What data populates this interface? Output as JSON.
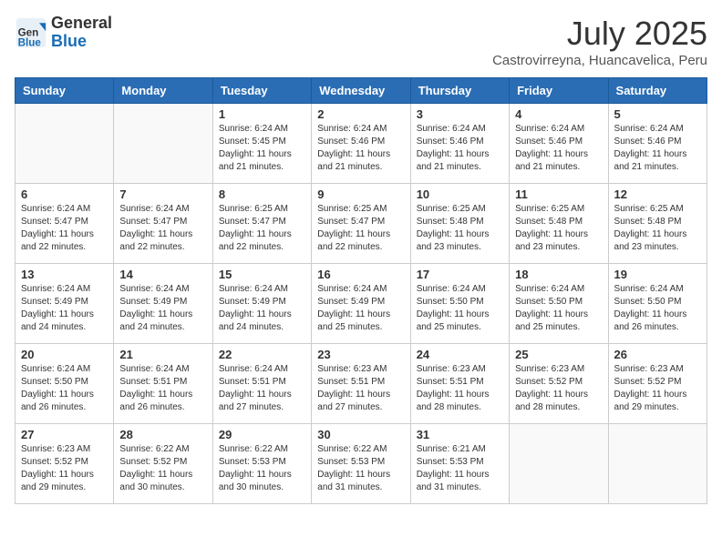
{
  "header": {
    "logo_general": "General",
    "logo_blue": "Blue",
    "month_year": "July 2025",
    "location": "Castrovirreyna, Huancavelica, Peru"
  },
  "days_of_week": [
    "Sunday",
    "Monday",
    "Tuesday",
    "Wednesday",
    "Thursday",
    "Friday",
    "Saturday"
  ],
  "weeks": [
    [
      {
        "day": "",
        "empty": true
      },
      {
        "day": "",
        "empty": true
      },
      {
        "day": "1",
        "sunrise": "6:24 AM",
        "sunset": "5:45 PM",
        "daylight": "11 hours and 21 minutes."
      },
      {
        "day": "2",
        "sunrise": "6:24 AM",
        "sunset": "5:46 PM",
        "daylight": "11 hours and 21 minutes."
      },
      {
        "day": "3",
        "sunrise": "6:24 AM",
        "sunset": "5:46 PM",
        "daylight": "11 hours and 21 minutes."
      },
      {
        "day": "4",
        "sunrise": "6:24 AM",
        "sunset": "5:46 PM",
        "daylight": "11 hours and 21 minutes."
      },
      {
        "day": "5",
        "sunrise": "6:24 AM",
        "sunset": "5:46 PM",
        "daylight": "11 hours and 21 minutes."
      }
    ],
    [
      {
        "day": "6",
        "sunrise": "6:24 AM",
        "sunset": "5:47 PM",
        "daylight": "11 hours and 22 minutes."
      },
      {
        "day": "7",
        "sunrise": "6:24 AM",
        "sunset": "5:47 PM",
        "daylight": "11 hours and 22 minutes."
      },
      {
        "day": "8",
        "sunrise": "6:25 AM",
        "sunset": "5:47 PM",
        "daylight": "11 hours and 22 minutes."
      },
      {
        "day": "9",
        "sunrise": "6:25 AM",
        "sunset": "5:47 PM",
        "daylight": "11 hours and 22 minutes."
      },
      {
        "day": "10",
        "sunrise": "6:25 AM",
        "sunset": "5:48 PM",
        "daylight": "11 hours and 23 minutes."
      },
      {
        "day": "11",
        "sunrise": "6:25 AM",
        "sunset": "5:48 PM",
        "daylight": "11 hours and 23 minutes."
      },
      {
        "day": "12",
        "sunrise": "6:25 AM",
        "sunset": "5:48 PM",
        "daylight": "11 hours and 23 minutes."
      }
    ],
    [
      {
        "day": "13",
        "sunrise": "6:24 AM",
        "sunset": "5:49 PM",
        "daylight": "11 hours and 24 minutes."
      },
      {
        "day": "14",
        "sunrise": "6:24 AM",
        "sunset": "5:49 PM",
        "daylight": "11 hours and 24 minutes."
      },
      {
        "day": "15",
        "sunrise": "6:24 AM",
        "sunset": "5:49 PM",
        "daylight": "11 hours and 24 minutes."
      },
      {
        "day": "16",
        "sunrise": "6:24 AM",
        "sunset": "5:49 PM",
        "daylight": "11 hours and 25 minutes."
      },
      {
        "day": "17",
        "sunrise": "6:24 AM",
        "sunset": "5:50 PM",
        "daylight": "11 hours and 25 minutes."
      },
      {
        "day": "18",
        "sunrise": "6:24 AM",
        "sunset": "5:50 PM",
        "daylight": "11 hours and 25 minutes."
      },
      {
        "day": "19",
        "sunrise": "6:24 AM",
        "sunset": "5:50 PM",
        "daylight": "11 hours and 26 minutes."
      }
    ],
    [
      {
        "day": "20",
        "sunrise": "6:24 AM",
        "sunset": "5:50 PM",
        "daylight": "11 hours and 26 minutes."
      },
      {
        "day": "21",
        "sunrise": "6:24 AM",
        "sunset": "5:51 PM",
        "daylight": "11 hours and 26 minutes."
      },
      {
        "day": "22",
        "sunrise": "6:24 AM",
        "sunset": "5:51 PM",
        "daylight": "11 hours and 27 minutes."
      },
      {
        "day": "23",
        "sunrise": "6:23 AM",
        "sunset": "5:51 PM",
        "daylight": "11 hours and 27 minutes."
      },
      {
        "day": "24",
        "sunrise": "6:23 AM",
        "sunset": "5:51 PM",
        "daylight": "11 hours and 28 minutes."
      },
      {
        "day": "25",
        "sunrise": "6:23 AM",
        "sunset": "5:52 PM",
        "daylight": "11 hours and 28 minutes."
      },
      {
        "day": "26",
        "sunrise": "6:23 AM",
        "sunset": "5:52 PM",
        "daylight": "11 hours and 29 minutes."
      }
    ],
    [
      {
        "day": "27",
        "sunrise": "6:23 AM",
        "sunset": "5:52 PM",
        "daylight": "11 hours and 29 minutes."
      },
      {
        "day": "28",
        "sunrise": "6:22 AM",
        "sunset": "5:52 PM",
        "daylight": "11 hours and 30 minutes."
      },
      {
        "day": "29",
        "sunrise": "6:22 AM",
        "sunset": "5:53 PM",
        "daylight": "11 hours and 30 minutes."
      },
      {
        "day": "30",
        "sunrise": "6:22 AM",
        "sunset": "5:53 PM",
        "daylight": "11 hours and 31 minutes."
      },
      {
        "day": "31",
        "sunrise": "6:21 AM",
        "sunset": "5:53 PM",
        "daylight": "11 hours and 31 minutes."
      },
      {
        "day": "",
        "empty": true
      },
      {
        "day": "",
        "empty": true
      }
    ]
  ],
  "labels": {
    "sunrise": "Sunrise:",
    "sunset": "Sunset:",
    "daylight": "Daylight:"
  }
}
